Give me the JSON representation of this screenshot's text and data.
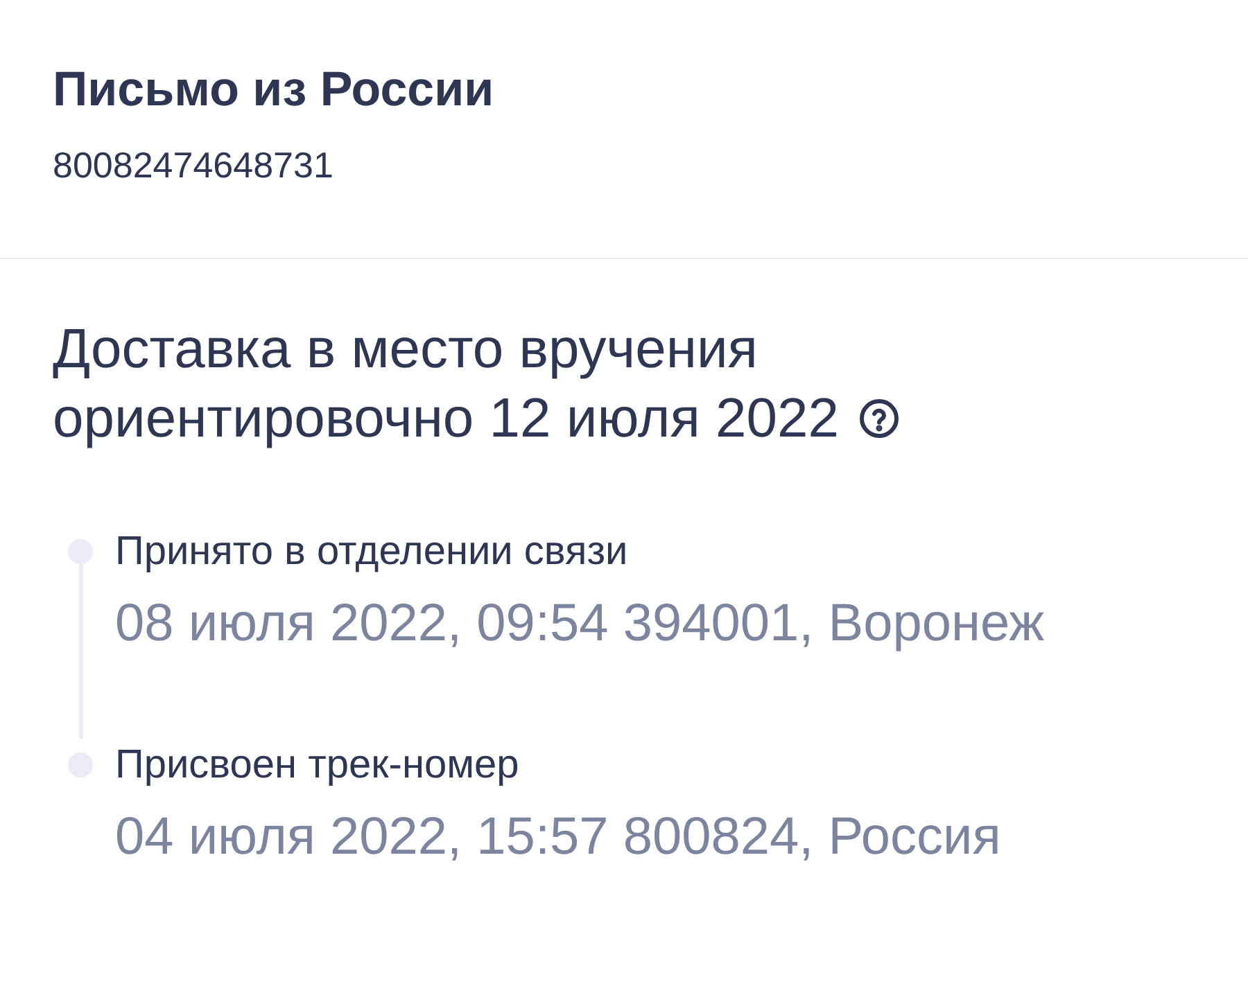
{
  "parcel": {
    "title": "Письмо из России",
    "track_number": "80082474648731"
  },
  "delivery": {
    "line_1": "Доставка в место вручения",
    "line_2": "ориентировочно 12 июля 2022"
  },
  "events": [
    {
      "status": "Принято в отделении связи",
      "details": "08 июля 2022, 09:54 394001, Воронеж"
    },
    {
      "status": "Присвоен трек-номер",
      "details": "04 июля 2022, 15:57 800824, Россия"
    }
  ]
}
